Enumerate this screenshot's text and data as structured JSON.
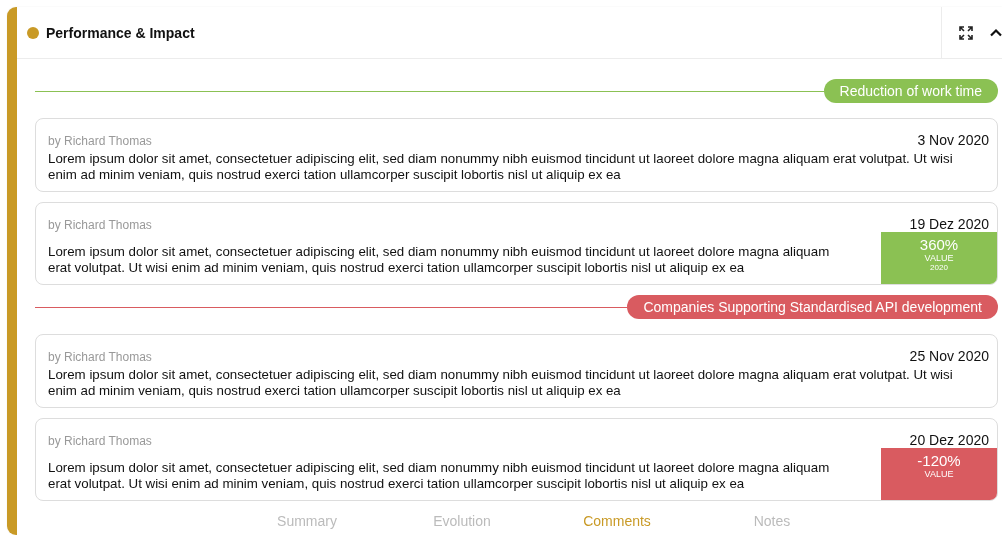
{
  "panel": {
    "title": "Performance & Impact"
  },
  "groups": [
    {
      "label": "Reduction of work time",
      "color": "#8bc153",
      "comments": [
        {
          "author": "by Richard Thomas",
          "date": "3 Nov 2020",
          "text": "Lorem ipsum dolor sit amet, consectetuer adipiscing elit, sed diam nonummy nibh euismod tincidunt ut laoreet dolore magna aliquam erat volutpat. Ut wisi enim ad minim veniam, quis nostrud exerci tation ullamcorper suscipit lobortis nisl ut aliquip ex ea"
        },
        {
          "author": "by Richard Thomas",
          "date": "19 Dez 2020",
          "text": "Lorem ipsum dolor sit amet, consectetuer adipiscing elit, sed diam nonummy nibh euismod tincidunt ut laoreet dolore magna aliquam erat volutpat. Ut wisi enim ad minim veniam, quis nostrud exerci tation ullamcorper suscipit lobortis nisl ut aliquip ex ea",
          "value": {
            "amount": "360%",
            "label": "VALUE",
            "year": "2020"
          }
        }
      ]
    },
    {
      "label": "Companies Supporting Standardised API development",
      "color": "#d95b60",
      "comments": [
        {
          "author": "by Richard Thomas",
          "date": "25 Nov 2020",
          "text": "Lorem ipsum dolor sit amet, consectetuer adipiscing elit, sed diam nonummy nibh euismod tincidunt ut laoreet dolore magna aliquam erat volutpat. Ut wisi enim ad minim veniam, quis nostrud exerci tation ullamcorper suscipit lobortis nisl ut aliquip ex ea"
        },
        {
          "author": "by Richard Thomas",
          "date": "20 Dez 2020",
          "text": "Lorem ipsum dolor sit amet, consectetuer adipiscing elit, sed diam nonummy nibh euismod tincidunt ut laoreet dolore magna aliquam erat volutpat. Ut wisi enim ad minim veniam, quis nostrud exerci tation ullamcorper suscipit lobortis nisl ut aliquip ex ea",
          "value": {
            "amount": "-120%",
            "label": "VALUE"
          }
        }
      ]
    }
  ],
  "tabs": [
    {
      "label": "Summary",
      "selected": false
    },
    {
      "label": "Evolution",
      "selected": false
    },
    {
      "label": "Comments",
      "selected": true
    },
    {
      "label": "Notes",
      "selected": false
    }
  ]
}
